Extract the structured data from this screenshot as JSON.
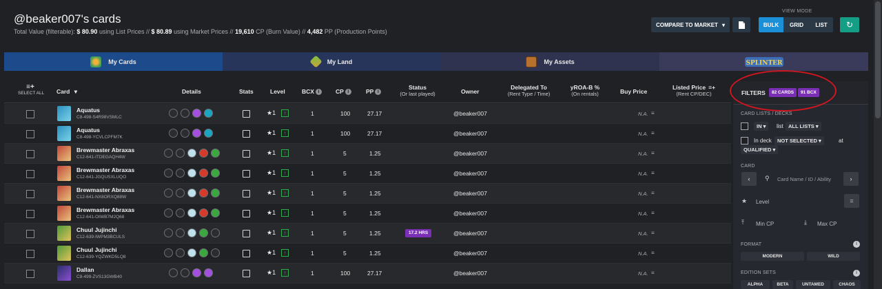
{
  "header": {
    "title": "@beaker007's cards",
    "summary": {
      "total_label": "Total Value (filterable):",
      "list_value": "$ 80.90",
      "list_label": "using List Prices //",
      "market_value": "$ 80.89",
      "market_label": "using Market Prices //",
      "cp_value": "19,610",
      "cp_label": "CP (Burn Value) //",
      "pp_value": "4,482",
      "pp_label": "PP (Production Points)"
    },
    "compare_label": "COMPARE TO MARKET",
    "view_mode_label": "VIEW MODE",
    "view_modes": [
      "BULK",
      "GRID",
      "LIST"
    ],
    "active_view_mode": "BULK"
  },
  "tabs": [
    {
      "label": "My Cards"
    },
    {
      "label": "My Land"
    },
    {
      "label": "My Assets"
    },
    {
      "label": ""
    }
  ],
  "table": {
    "headers": {
      "select_all": "SELECT ALL",
      "card": "Card",
      "details": "Details",
      "stats": "Stats",
      "level": "Level",
      "bcx": "BCX",
      "cp": "CP",
      "pp": "PP",
      "status": "Status",
      "status_sub": "(Or last played)",
      "owner": "Owner",
      "delegated": "Delegated To",
      "delegated_sub": "(Rent Type / Time)",
      "yroa": "yROA-B %",
      "yroa_sub": "(On rentals)",
      "buy_price": "Buy Price",
      "listed_price": "Listed Price",
      "listed_price_sub": "(Rent CP/DEC)"
    },
    "rows": [
      {
        "name": "Aquatus",
        "id": "C8-498-S4R98VSMLC",
        "level": "1",
        "bcx": "1",
        "cp": "100",
        "pp": "27.17",
        "status": "",
        "owner": "@beaker007",
        "buy_price": "N.A."
      },
      {
        "name": "Aquatus",
        "id": "C8-498-YCVLCPFM7K",
        "level": "1",
        "bcx": "1",
        "cp": "100",
        "pp": "27.17",
        "status": "",
        "owner": "@beaker007",
        "buy_price": "N.A."
      },
      {
        "name": "Brewmaster Abraxas",
        "id": "C12-641-ITDEGAQH4W",
        "level": "1",
        "bcx": "1",
        "cp": "5",
        "pp": "1.25",
        "status": "",
        "owner": "@beaker007",
        "buy_price": "N.A."
      },
      {
        "name": "Brewmaster Abraxas",
        "id": "C12-641-JGQUSXLUQO",
        "level": "1",
        "bcx": "1",
        "cp": "5",
        "pp": "1.25",
        "status": "",
        "owner": "@beaker007",
        "buy_price": "N.A."
      },
      {
        "name": "Brewmaster Abraxas",
        "id": "C12-641-NX8ORXQ88W",
        "level": "1",
        "bcx": "1",
        "cp": "5",
        "pp": "1.25",
        "status": "",
        "owner": "@beaker007",
        "buy_price": "N.A."
      },
      {
        "name": "Brewmaster Abraxas",
        "id": "C12-641-OIWB7M2Q68",
        "level": "1",
        "bcx": "1",
        "cp": "5",
        "pp": "1.25",
        "status": "",
        "owner": "@beaker007",
        "buy_price": "N.A."
      },
      {
        "name": "Chuul Jujinchi",
        "id": "C12-639-IWPM3BCULS",
        "level": "1",
        "bcx": "1",
        "cp": "5",
        "pp": "1.25",
        "status": "17.2 HRS",
        "owner": "@beaker007",
        "buy_price": "N.A."
      },
      {
        "name": "Chuul Jujinchi",
        "id": "C12-639-YQZWKD5LQ8",
        "level": "1",
        "bcx": "1",
        "cp": "5",
        "pp": "1.25",
        "status": "",
        "owner": "@beaker007",
        "buy_price": "N.A."
      },
      {
        "name": "Dallan",
        "id": "C8-499-ZVS13GWB40",
        "level": "1",
        "bcx": "1",
        "cp": "100",
        "pp": "27.17",
        "status": "",
        "owner": "@beaker007",
        "buy_price": "N.A."
      }
    ]
  },
  "filters": {
    "label": "FILTERS",
    "cards_badge": "82 CARDS",
    "bcx_badge": "91 BCX",
    "card_lists_label": "CARD LISTS / DECKS",
    "in_label": "IN",
    "list_label": "list",
    "all_lists": "ALL LISTS",
    "in_deck_label": "In deck",
    "not_selected": "NOT SELECTED",
    "at_label": "at",
    "qualified": "QUALIFIED",
    "card_label": "CARD",
    "search_placeholder": "Card Name / ID / Ability",
    "level_label": "Level",
    "level_eq": "=",
    "min_cp": "Min CP",
    "max_cp": "Max CP",
    "format_label": "FORMAT",
    "formats": [
      "MODERN",
      "WILD"
    ],
    "edition_label": "EDITION SETS",
    "editions": [
      "ALPHA",
      "BETA",
      "UNTAMED",
      "CHAOS"
    ]
  },
  "colors": {
    "accent_blue": "#1b8fd8",
    "refresh_green": "#159e86",
    "badge_purple": "#7a2fb5",
    "annotation_red": "#d0161f"
  }
}
